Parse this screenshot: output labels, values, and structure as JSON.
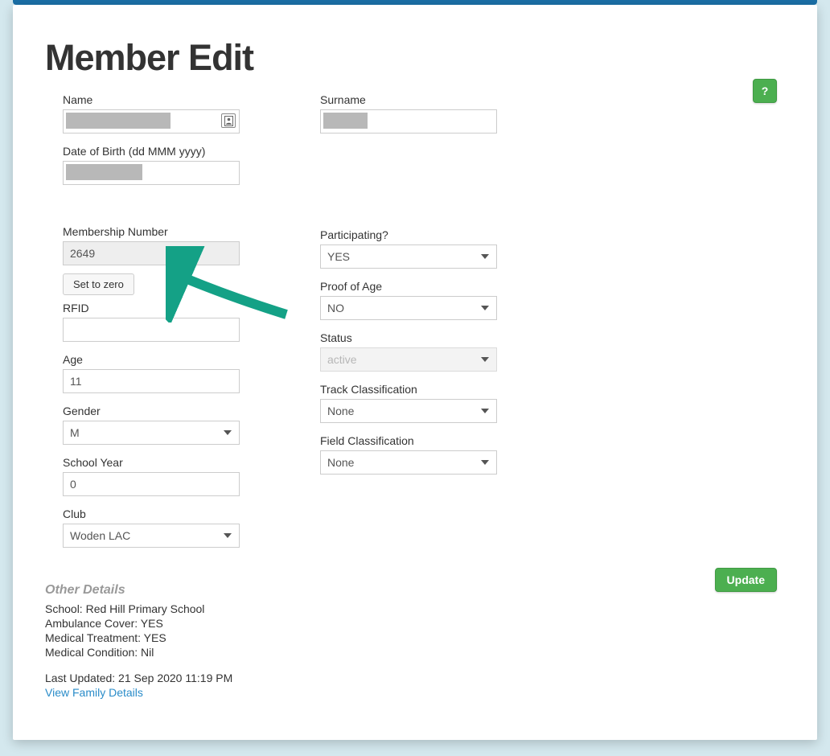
{
  "page": {
    "title": "Member Edit"
  },
  "help": {
    "label": "?"
  },
  "left": {
    "name_label": "Name",
    "name_value": "",
    "surname_label": "Surname",
    "surname_value": "",
    "dob_label": "Date of Birth (dd MMM yyyy)",
    "dob_value": "",
    "membership_label": "Membership Number",
    "membership_value": "2649",
    "set_zero_label": "Set to zero",
    "rfid_label": "RFID",
    "rfid_value": "",
    "age_label": "Age",
    "age_value": "11",
    "gender_label": "Gender",
    "gender_value": "M",
    "school_year_label": "School Year",
    "school_year_value": "0",
    "club_label": "Club",
    "club_value": "Woden LAC"
  },
  "right": {
    "participating_label": "Participating?",
    "participating_value": "YES",
    "proof_label": "Proof of Age",
    "proof_value": "NO",
    "status_label": "Status",
    "status_value": "active",
    "track_label": "Track Classification",
    "track_value": "None",
    "field_label": "Field Classification",
    "field_value": "None"
  },
  "update_label": "Update",
  "other": {
    "heading": "Other Details",
    "school": "School: Red Hill Primary School",
    "ambulance": "Ambulance Cover: YES",
    "medical_treatment": "Medical Treatment: YES",
    "medical_condition": "Medical Condition: Nil",
    "last_updated": "Last Updated: 21 Sep 2020 11:19 PM",
    "view_family": "View Family Details"
  }
}
